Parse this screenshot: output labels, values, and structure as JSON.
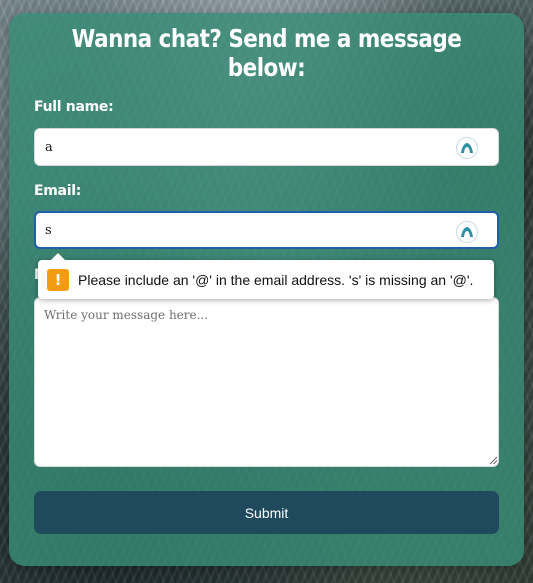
{
  "form": {
    "title": "Wanna chat? Send me a message below:",
    "full_name": {
      "label": "Full name:",
      "value": "a",
      "autofill_icon": "password-manager-icon"
    },
    "email": {
      "label": "Email:",
      "value": "s",
      "autofill_icon": "password-manager-icon"
    },
    "message": {
      "label": "Message:",
      "placeholder": "Write your message here..."
    },
    "submit_label": "Submit"
  },
  "validation_tooltip": {
    "icon": "warning-icon",
    "icon_glyph": "!",
    "text": "Please include an '@' in the email address. 's' is missing an '@'."
  },
  "colors": {
    "card": "#388c76",
    "submit_button": "#1f4a5e",
    "focus_border": "#1f5fa8",
    "warning": "#f39c12"
  }
}
